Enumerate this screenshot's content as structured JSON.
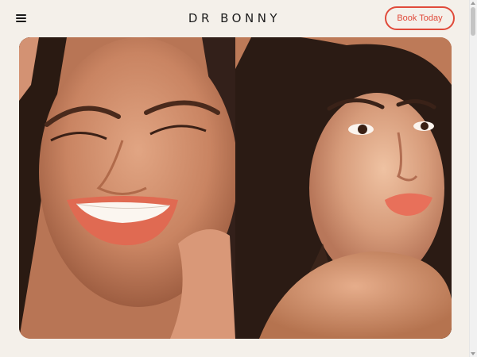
{
  "header": {
    "logo": "DR BONNY",
    "book_label": "Book Today",
    "menu_icon": "hamburger-menu-icon"
  },
  "gallery": {
    "images": [
      {
        "subject": "smiling-freckled-woman-photo"
      },
      {
        "subject": "freckled-woman-portrait-photo"
      }
    ]
  },
  "colors": {
    "background": "#f4f0ea",
    "accent": "#e04a3a",
    "text": "#1d1d1d"
  }
}
